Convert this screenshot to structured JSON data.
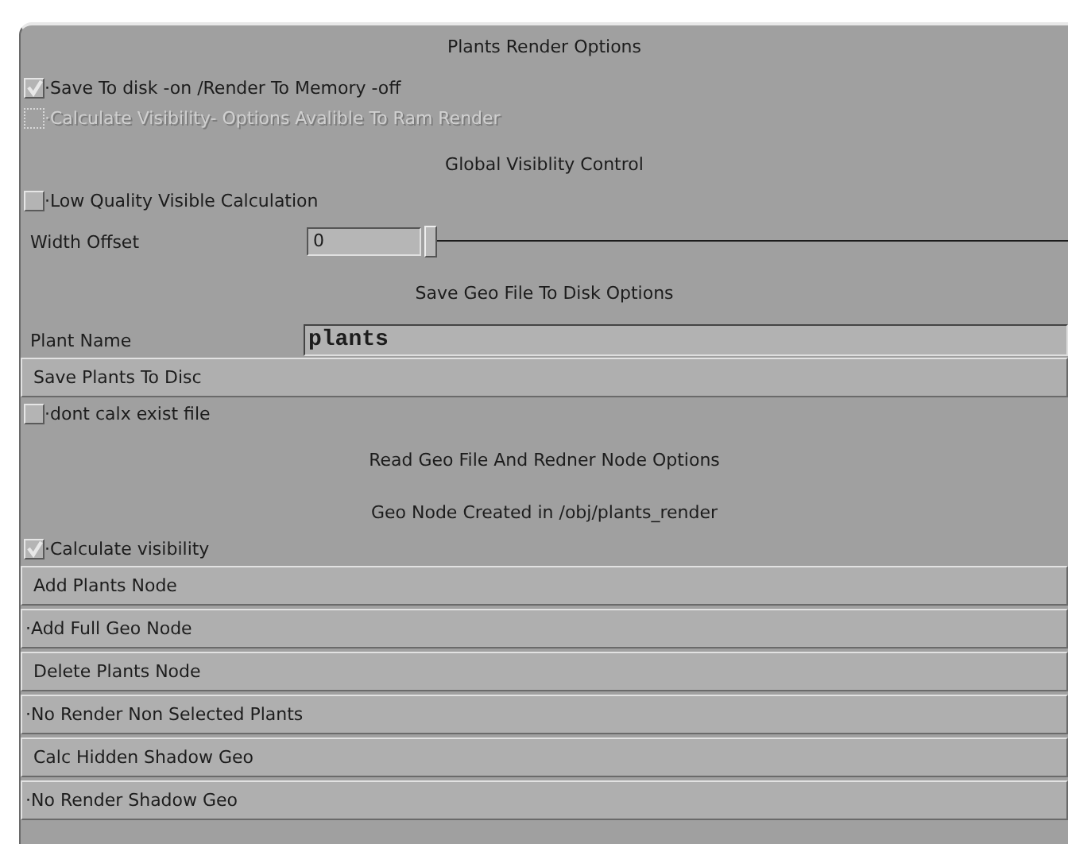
{
  "panel": {
    "title": "Plants Render Options"
  },
  "items": [
    {
      "kind": "checkbox",
      "label": "·Save To disk -on /Render To Memory -off",
      "checked": true,
      "disabled": false
    },
    {
      "kind": "checkbox",
      "label": "·Calculate Visibility- Options Avalible To Ram Render",
      "checked": false,
      "disabled": true
    },
    {
      "kind": "header",
      "label": "Global Visiblity Control"
    },
    {
      "kind": "checkbox",
      "label": "·Low Quality Visible Calculation",
      "checked": false,
      "disabled": false
    },
    {
      "kind": "slider",
      "label": "Width Offset",
      "value": "0",
      "level": 0
    },
    {
      "kind": "header",
      "label": "Save Geo File To Disk Options"
    },
    {
      "kind": "field",
      "label": "Plant Name",
      "value": "plants"
    },
    {
      "kind": "button",
      "label": "Save Plants To Disc"
    },
    {
      "kind": "checkbox",
      "label": "·dont calx exist file",
      "checked": false,
      "disabled": false
    },
    {
      "kind": "header",
      "label": "Read Geo File And Redner Node Options"
    },
    {
      "kind": "header",
      "label": "Geo Node Created in /obj/plants_render"
    },
    {
      "kind": "checkbox",
      "label": "·Calculate visibility",
      "checked": true,
      "disabled": false
    },
    {
      "kind": "button",
      "label": "Add Plants Node"
    },
    {
      "kind": "button",
      "label": "·Add Full Geo Node"
    },
    {
      "kind": "button",
      "label": "Delete Plants Node"
    },
    {
      "kind": "button",
      "label": "·No Render Non Selected Plants"
    },
    {
      "kind": "button",
      "label": "Calc Hidden Shadow Geo"
    },
    {
      "kind": "button",
      "label": "·No Render Shadow Geo"
    }
  ]
}
